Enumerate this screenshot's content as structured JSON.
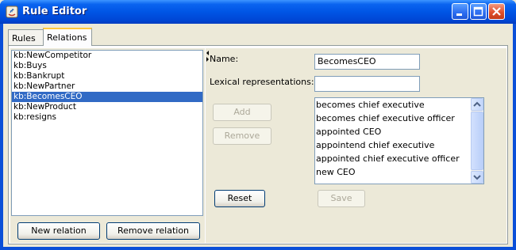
{
  "window": {
    "title": "Rule Editor"
  },
  "tabs": [
    {
      "label": "Rules"
    },
    {
      "label": "Relations"
    }
  ],
  "relations": {
    "items": [
      "kb:NewCompetitor",
      "kb:Buys",
      "kb:Bankrupt",
      "kb:NewPartner",
      "kb:BecomesCEO",
      "kb:NewProduct",
      "kb:resigns"
    ],
    "selected": "kb:BecomesCEO",
    "new_button": "New relation",
    "remove_button": "Remove relation"
  },
  "editor": {
    "name_label": "Name:",
    "name_value": "BecomesCEO",
    "lexical_label": "Lexical representations:",
    "lexical_value": "",
    "add_button": "Add",
    "remove_button": "Remove",
    "synonyms": [
      "becomes chief executive",
      "becomes chief executive officer",
      "appointed CEO",
      "appointend chief executive",
      "appointed chief executive officer",
      "new CEO"
    ],
    "reset_button": "Reset",
    "save_button": "Save"
  },
  "colors": {
    "titlebar": "#0055e5",
    "selection": "#316ac5",
    "active_tab_accent": "#ffc83c",
    "face": "#ece9d8"
  },
  "icons": [
    "java-app-icon",
    "minimize-icon",
    "maximize-icon",
    "close-icon",
    "split-arrow-icon",
    "scroll-up-icon",
    "scroll-down-icon"
  ]
}
